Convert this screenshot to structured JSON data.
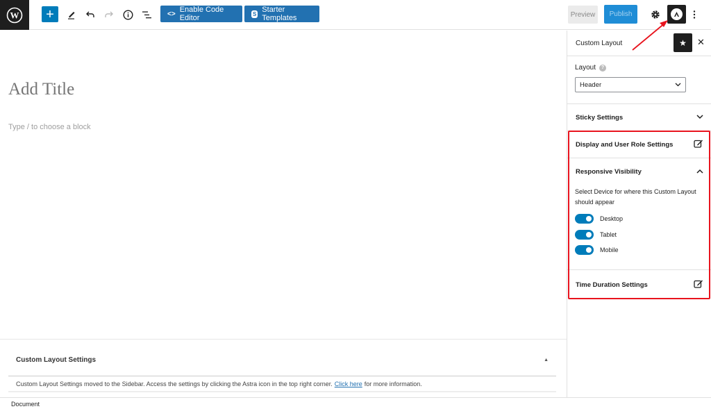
{
  "toolbar": {
    "logo_icon": "wordpress-logo-icon",
    "add_block_icon": "plus-icon",
    "tools_icon": "pencil-icon",
    "undo_icon": "undo-icon",
    "redo_icon": "redo-icon",
    "details_icon": "info-icon",
    "list_view_icon": "list-view-icon",
    "enable_code_editor_label": "Enable Code Editor",
    "starter_templates_label": "Starter Templates",
    "preview_label": "Preview",
    "publish_label": "Publish",
    "settings_icon": "gear-icon",
    "astra_icon": "astra-icon",
    "more_icon": "kebab-menu-icon"
  },
  "editor": {
    "title_placeholder": "Add Title",
    "block_placeholder": "Type / to choose a block"
  },
  "meta_box": {
    "title": "Custom Layout Settings",
    "message_before_link": "Custom Layout Settings moved to the Sidebar. Access the settings by clicking the Astra icon in the top right corner.",
    "link_text": "Click here",
    "message_after_link": "for more information."
  },
  "footer": {
    "breadcrumb": "Document"
  },
  "sidebar": {
    "title": "Custom Layout",
    "layout_label": "Layout",
    "layout_value": "Header",
    "sticky_settings": "Sticky Settings",
    "display_user_role": "Display and User Role Settings",
    "responsive_visibility": {
      "title": "Responsive Visibility",
      "description": "Select Device for where this Custom Layout should appear",
      "devices": [
        {
          "label": "Desktop",
          "enabled": true
        },
        {
          "label": "Tablet",
          "enabled": true
        },
        {
          "label": "Mobile",
          "enabled": true
        }
      ]
    },
    "time_duration": "Time Duration Settings"
  },
  "colors": {
    "accent": "#007cba",
    "annotation_red": "#e8131d",
    "dark": "#1e1e1e"
  }
}
